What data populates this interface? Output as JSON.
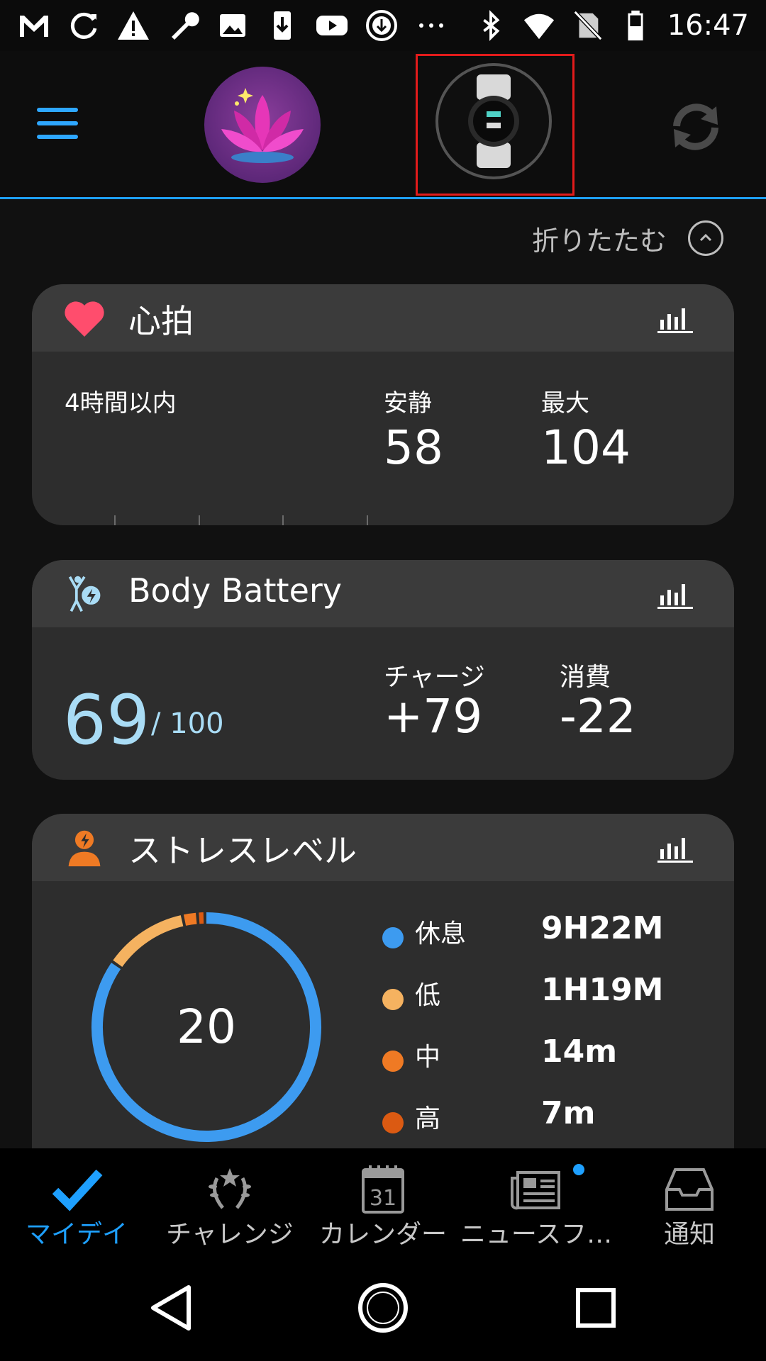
{
  "status_bar": {
    "icons": [
      "gmail-icon",
      "sync-icon",
      "warning-icon",
      "wrench-icon",
      "image-icon",
      "download-icon",
      "youtube-icon",
      "download-circle-icon",
      "more-dots-icon"
    ],
    "right_icons": [
      "bluetooth-icon",
      "wifi-icon",
      "no-sim-icon",
      "battery-icon"
    ],
    "time": "16:47"
  },
  "app_bar": {
    "menu_icon": "hamburger-icon",
    "avatar_icon": "lotus-icon",
    "device_icon": "watch-icon",
    "sync_icon": "sync-icon",
    "accent": "#1ea0ff",
    "highlight": "#e21b1b"
  },
  "collapse": {
    "label": "折りたたむ",
    "icon": "chevron-up-icon"
  },
  "heart_rate": {
    "title": "心拍",
    "icon": "heart-icon",
    "period_label": "4時間以内",
    "resting_label": "安静",
    "resting_value": "58",
    "max_label": "最大",
    "max_value": "104"
  },
  "body_battery": {
    "title": "Body Battery",
    "icon": "body-battery-icon",
    "current_value": "69",
    "total": "/ 100",
    "charge_label": "チャージ",
    "charge_value": "+79",
    "drain_label": "消費",
    "drain_value": "-22"
  },
  "stress": {
    "title": "ストレスレベル",
    "icon": "stress-icon",
    "score": "20",
    "legend": [
      {
        "label": "休息",
        "value": "9H22M",
        "color": "#3d9bf0"
      },
      {
        "label": "低",
        "value": "1H19M",
        "color": "#f5b260"
      },
      {
        "label": "中",
        "value": "14m",
        "color": "#ef7a24"
      },
      {
        "label": "高",
        "value": "7m",
        "color": "#db5a12"
      }
    ],
    "minutes": {
      "rest": 562,
      "low": 79,
      "medium": 14,
      "high": 7
    }
  },
  "bottom_nav": {
    "items": [
      {
        "label": "マイデイ",
        "icon": "checkmark-icon",
        "active": true
      },
      {
        "label": "チャレンジ",
        "icon": "laurel-icon"
      },
      {
        "label": "カレンダー",
        "icon": "calendar-icon",
        "day": "31"
      },
      {
        "label": "ニュースフ…",
        "icon": "newsfeed-icon"
      },
      {
        "label": "通知",
        "icon": "inbox-icon"
      }
    ]
  },
  "system_nav": [
    "back-icon",
    "home-icon",
    "recents-icon"
  ]
}
